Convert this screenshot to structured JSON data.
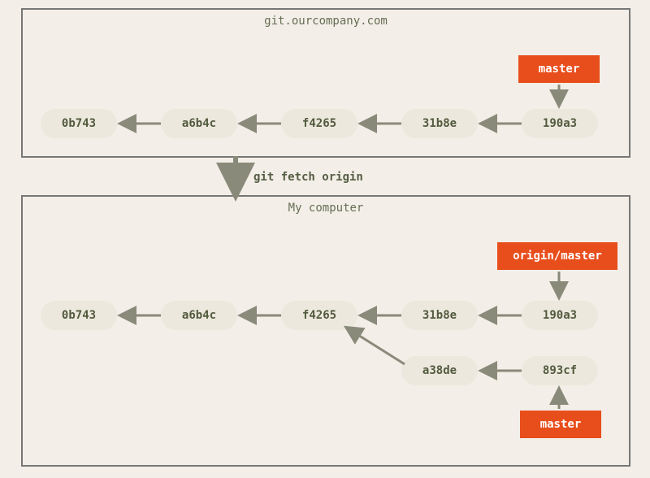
{
  "remote": {
    "title": "git.ourcompany.com",
    "commits": [
      "0b743",
      "a6b4c",
      "f4265",
      "31b8e",
      "190a3"
    ],
    "refs": [
      {
        "label": "master"
      }
    ]
  },
  "command": "git fetch origin",
  "local": {
    "title": "My computer",
    "commitsRow1": [
      "0b743",
      "a6b4c",
      "f4265",
      "31b8e",
      "190a3"
    ],
    "commitsRow2": [
      "a38de",
      "893cf"
    ],
    "refs": [
      {
        "label": "origin/master"
      },
      {
        "label": "master"
      }
    ]
  }
}
